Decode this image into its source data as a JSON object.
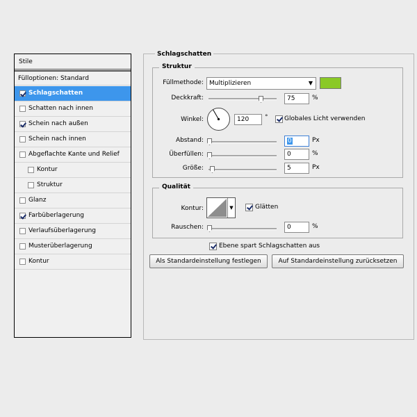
{
  "styles": {
    "header": "Stile",
    "fill_options": "Fülloptionen: Standard",
    "items": [
      {
        "label": "Schlagschatten",
        "checked": true,
        "selected": true
      },
      {
        "label": "Schatten nach innen",
        "checked": false
      },
      {
        "label": "Schein nach außen",
        "checked": true
      },
      {
        "label": "Schein nach innen",
        "checked": false
      },
      {
        "label": "Abgeflachte Kante und Relief",
        "checked": false
      },
      {
        "label": "Kontur",
        "checked": false,
        "sub": true
      },
      {
        "label": "Struktur",
        "checked": false,
        "sub": true
      },
      {
        "label": "Glanz",
        "checked": false
      },
      {
        "label": "Farbüberlagerung",
        "checked": true
      },
      {
        "label": "Verlaufsüberlagerung",
        "checked": false
      },
      {
        "label": "Musterüberlagerung",
        "checked": false
      },
      {
        "label": "Kontur",
        "checked": false
      }
    ]
  },
  "panel": {
    "title": "Schlagschatten",
    "structure": {
      "title": "Struktur",
      "blend_mode_label": "Füllmethode:",
      "blend_mode_value": "Multiplizieren",
      "color": "#8ac926",
      "opacity_label": "Deckkraft:",
      "opacity_value": "75",
      "opacity_unit": "%",
      "angle_label": "Winkel:",
      "angle_value": "120",
      "angle_unit": "°",
      "global_light_label": "Globales Licht verwenden",
      "global_light_checked": true,
      "distance_label": "Abstand:",
      "distance_value": "0",
      "distance_unit": "Px",
      "spread_label": "Überfüllen:",
      "spread_value": "0",
      "spread_unit": "%",
      "size_label": "Größe:",
      "size_value": "5",
      "size_unit": "Px"
    },
    "quality": {
      "title": "Qualität",
      "contour_label": "Kontur:",
      "antialias_label": "Glätten",
      "antialias_checked": true,
      "noise_label": "Rauschen:",
      "noise_value": "0",
      "noise_unit": "%"
    },
    "knockout_label": "Ebene spart Schlagschatten aus",
    "knockout_checked": true,
    "btn_make_default": "Als Standardeinstellung festlegen",
    "btn_reset_default": "Auf Standardeinstellung zurücksetzen"
  }
}
